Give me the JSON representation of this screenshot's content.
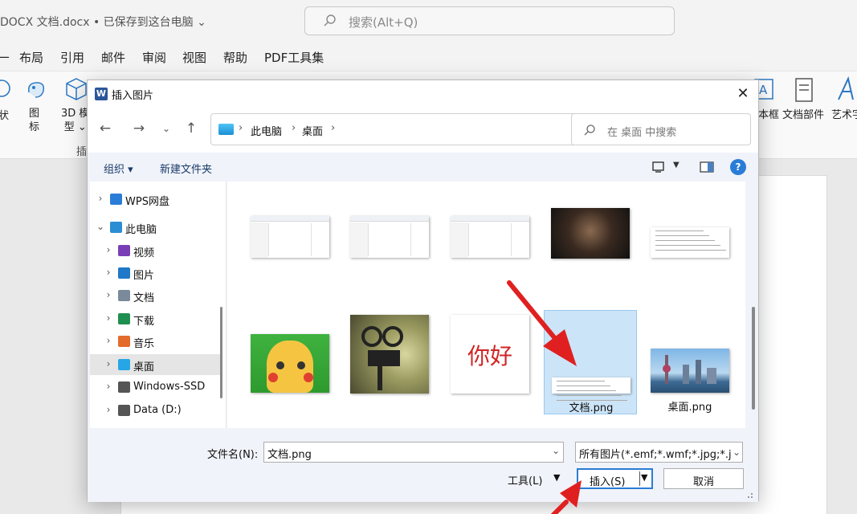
{
  "word": {
    "doc_title": "DOCX 文档.docx • 已保存到这台电脑 ⌄",
    "search_placeholder": "搜索(Alt+Q)",
    "menu": [
      "ㄧ",
      "布局",
      "引用",
      "邮件",
      "审阅",
      "视图",
      "帮助",
      "PDF工具集"
    ],
    "ribbon_left": [
      "状",
      "图\n标",
      "3D 模\n型 ⌄",
      "插"
    ],
    "ribbon_right": [
      "本框",
      "文档部件",
      "艺术字"
    ]
  },
  "dialog": {
    "title": "插入图片",
    "address": {
      "segments": [
        "此电脑",
        "桌面"
      ]
    },
    "search_placeholder": "在 桌面 中搜索",
    "toolbar": {
      "organize": "组织 ▾",
      "new_folder": "新建文件夹"
    },
    "sidebar": [
      {
        "label": "WPS网盘",
        "level": 0,
        "expanded": false,
        "icon": "cloud-icon",
        "color": "#2a7dd6"
      },
      {
        "label": "此电脑",
        "level": 0,
        "expanded": true,
        "icon": "computer-icon",
        "color": "#2b8ed4"
      },
      {
        "label": "视频",
        "level": 1,
        "expanded": false,
        "icon": "video-icon",
        "color": "#7b3fb5"
      },
      {
        "label": "图片",
        "level": 1,
        "expanded": false,
        "icon": "pictures-icon",
        "color": "#1f78c8"
      },
      {
        "label": "文档",
        "level": 1,
        "expanded": false,
        "icon": "documents-icon",
        "color": "#7a8a9a"
      },
      {
        "label": "下载",
        "level": 1,
        "expanded": false,
        "icon": "download-icon",
        "color": "#1f8f4f"
      },
      {
        "label": "音乐",
        "level": 1,
        "expanded": false,
        "icon": "music-icon",
        "color": "#e36b2c"
      },
      {
        "label": "桌面",
        "level": 1,
        "expanded": false,
        "icon": "desktop-icon",
        "color": "#27a6e6",
        "selected": true
      },
      {
        "label": "Windows-SSD",
        "level": 1,
        "expanded": false,
        "icon": "drive-icon",
        "color": "#555555"
      },
      {
        "label": "Data (D:)",
        "level": 1,
        "expanded": false,
        "icon": "drive-icon",
        "color": "#555555"
      }
    ],
    "files": [
      {
        "name": "",
        "kind": "doc-screenshot"
      },
      {
        "name": "",
        "kind": "doc-screenshot"
      },
      {
        "name": "",
        "kind": "doc-screenshot"
      },
      {
        "name": "",
        "kind": "photo-dark"
      },
      {
        "name": "",
        "kind": "doc-text"
      },
      {
        "name": "",
        "kind": "cartoon"
      },
      {
        "name": "",
        "kind": "projector"
      },
      {
        "name": "",
        "kind": "hello-text",
        "text": "你好"
      },
      {
        "name": "文档.png",
        "kind": "doc-text",
        "selected": true
      },
      {
        "name": "桌面.png",
        "kind": "city"
      }
    ],
    "filename_label": "文件名(N):",
    "filename_value": "文档.png",
    "filetype_value": "所有图片(*.emf;*.wmf;*.jpg;*.j",
    "tools_label": "工具(L)",
    "insert_label": "插入(S)",
    "cancel_label": "取消",
    "annotation_color": "#e02020",
    "accent": "#2a7dd6"
  }
}
